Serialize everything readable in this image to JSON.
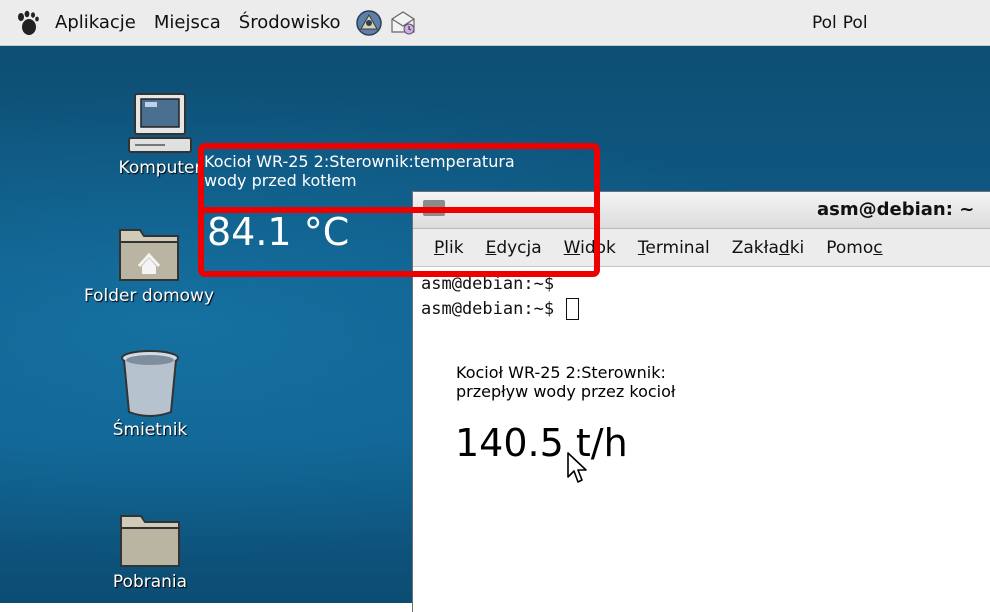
{
  "panel": {
    "menus": [
      "Aplikacje",
      "Miejsca",
      "Środowisko"
    ],
    "status_right": [
      "Pol",
      "Pol"
    ]
  },
  "desktop": {
    "icons": [
      {
        "label": "Komputer"
      },
      {
        "label": "Folder domowy"
      },
      {
        "label": "Śmietnik"
      },
      {
        "label": "Pobrania"
      }
    ]
  },
  "terminal": {
    "title": "asm@debian: ~",
    "menu": [
      {
        "mnemonic": "P",
        "rest": "lik"
      },
      {
        "mnemonic": "E",
        "rest": "dycja"
      },
      {
        "mnemonic": "W",
        "rest": "idok"
      },
      {
        "mnemonic": "T",
        "rest": "erminal"
      },
      {
        "pre": "Zakła",
        "mnemonic": "d",
        "rest": "ki"
      },
      {
        "pre": "Pomo",
        "mnemonic": "c",
        "rest": ""
      }
    ],
    "lines": [
      "asm@debian:~$",
      "asm@debian:~$ "
    ]
  },
  "widgets": {
    "temperature": {
      "title": "Kocioł WR-25 2:Sterownik:temperatura\nwody przed kotłem",
      "value": "84.1 °C",
      "color": "#ffffff"
    },
    "flow": {
      "title": "Kocioł WR-25 2:Sterownik:\nprzepływ wody przez kocioł",
      "value": "140.5 t/h",
      "color": "#000000"
    }
  },
  "colors": {
    "highlight": "#ee0000",
    "desktop_bg": "#0f5b86"
  }
}
